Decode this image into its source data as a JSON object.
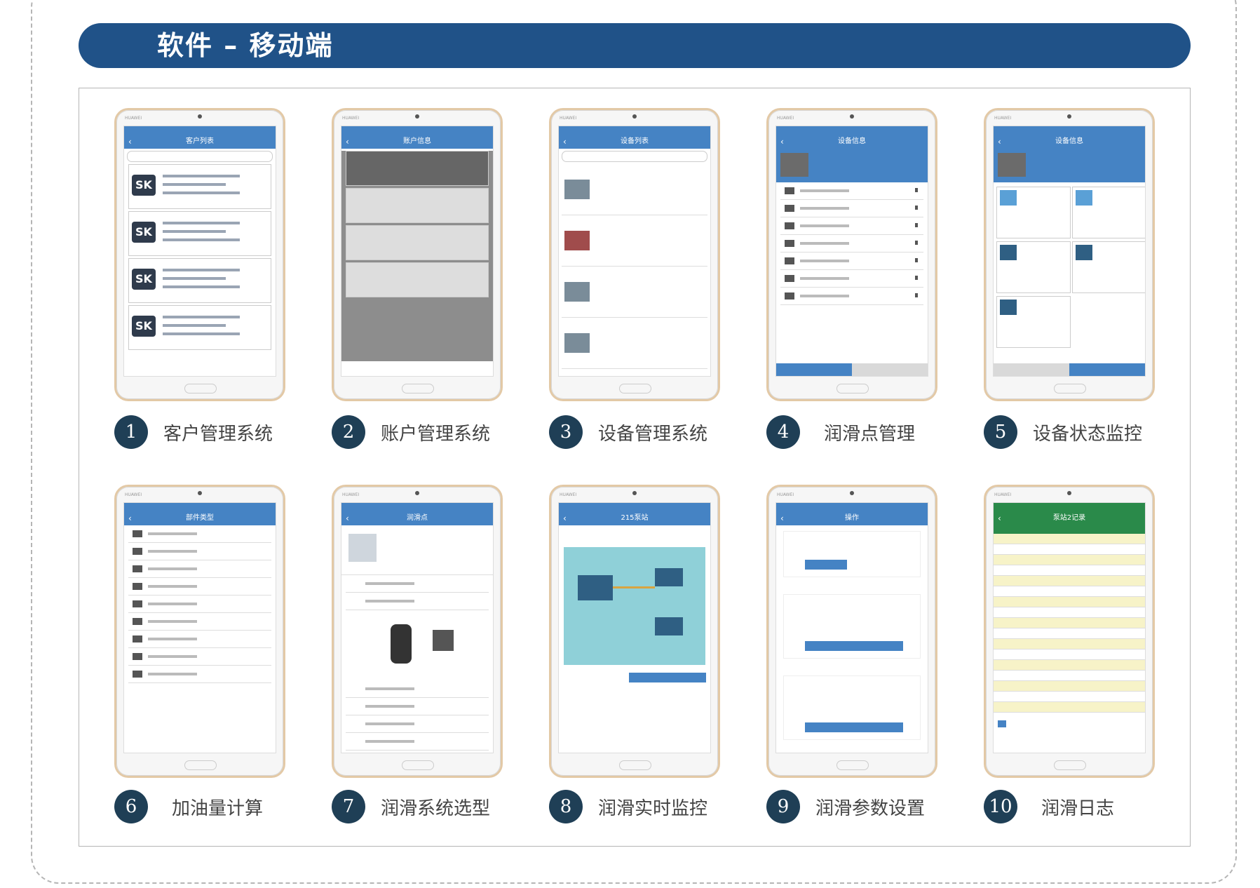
{
  "header": {
    "title": "软件 – 移动端"
  },
  "items": [
    {
      "number": "1",
      "label": "客户管理系统",
      "screen": {
        "title": "客户列表"
      }
    },
    {
      "number": "2",
      "label": "账户管理系统",
      "screen": {
        "title": "账户信息"
      }
    },
    {
      "number": "3",
      "label": "设备管理系统",
      "screen": {
        "title": "设备列表"
      }
    },
    {
      "number": "4",
      "label": "润滑点管理",
      "screen": {
        "title": "设备信息"
      }
    },
    {
      "number": "5",
      "label": "设备状态监控",
      "screen": {
        "title": "设备信息"
      }
    },
    {
      "number": "6",
      "label": "加油量计算",
      "screen": {
        "title": "部件类型"
      }
    },
    {
      "number": "7",
      "label": "润滑系统选型",
      "screen": {
        "title": "润滑点"
      }
    },
    {
      "number": "8",
      "label": "润滑实时监控",
      "screen": {
        "title": "215泵站"
      }
    },
    {
      "number": "9",
      "label": "润滑参数设置",
      "screen": {
        "title": "操作"
      }
    },
    {
      "number": "10",
      "label": "润滑日志",
      "screen": {
        "title": "泵站2记录"
      }
    }
  ],
  "phone": {
    "brand": "HUAWEI",
    "logo_text": "SK"
  },
  "colors": {
    "header": "#205288",
    "number_circle": "#1f3f56",
    "app_bar": "#4583c4",
    "teal_screen": "#79c2cc"
  }
}
